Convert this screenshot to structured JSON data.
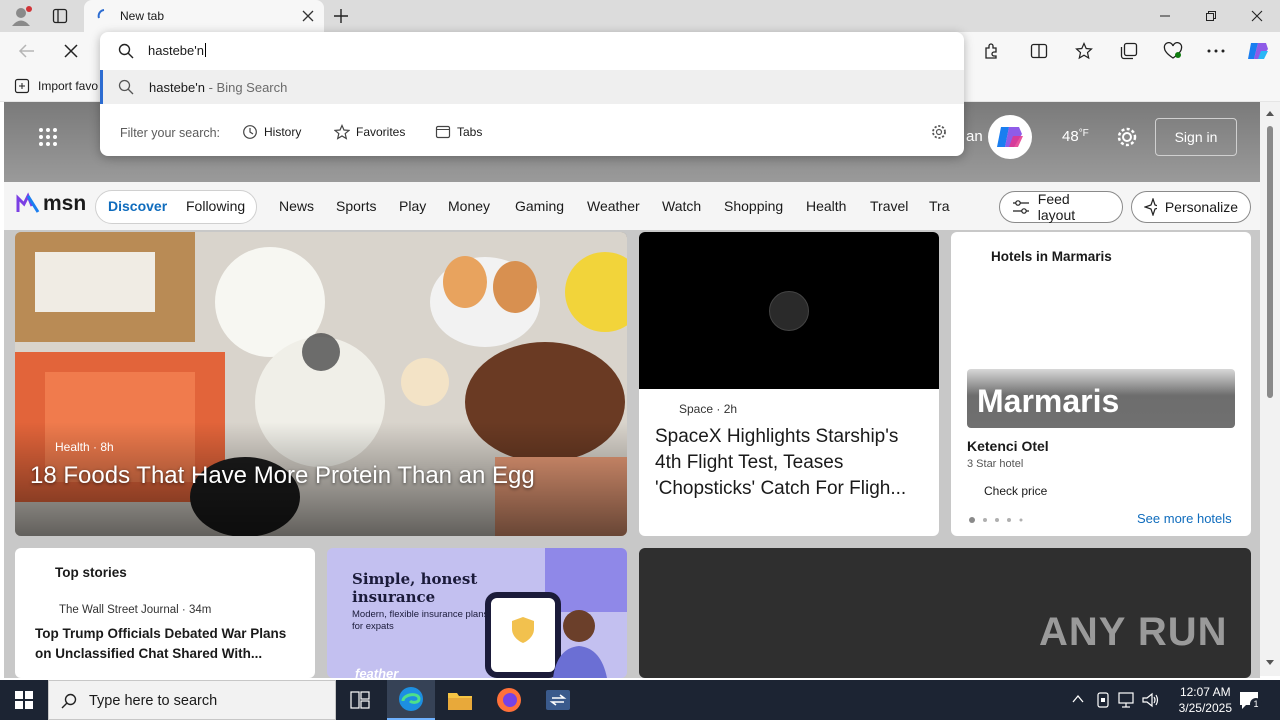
{
  "browser": {
    "tab_title": "New tab",
    "address_input": "hastebe'n",
    "favorites_import_label": "Import favo",
    "suggestion": {
      "query": "hastebe'n",
      "suffix": " - Bing Search"
    },
    "filter_label": "Filter your search:",
    "filters": [
      "History",
      "Favorites",
      "Tabs"
    ]
  },
  "msn_header": {
    "weather_temp": "48",
    "weather_unit": "°F",
    "sign_in": "Sign in",
    "partial_text": "an"
  },
  "msn_nav": {
    "logo": "msn",
    "tabs": [
      "Discover",
      "Following"
    ],
    "active_tab": "Discover",
    "items": [
      "News",
      "Sports",
      "Play",
      "Money",
      "Gaming",
      "Weather",
      "Watch",
      "Shopping",
      "Health",
      "Travel",
      "Tra"
    ],
    "feed_layout": "Feed layout",
    "personalize": "Personalize"
  },
  "cards": {
    "hero": {
      "category": "Health",
      "age": "8h",
      "title": "18 Foods That Have More Protein Than an Egg"
    },
    "space": {
      "category": "Space",
      "age": "2h",
      "title": "SpaceX Highlights Starship's 4th Flight Test, Teases 'Chopsticks' Catch For Fligh..."
    },
    "hotels": {
      "header": "Hotels in Marmaris",
      "image_label": "Marmaris",
      "name": "Ketenci Otel",
      "rating": "3 Star hotel",
      "cta": "Check price",
      "more": "See more hotels"
    },
    "top_stories": {
      "header": "Top stories",
      "source": "The Wall Street Journal",
      "age": "34m",
      "title": "Top Trump Officials Debated War Plans on Unclassified Chat Shared With..."
    },
    "ad": {
      "headline": "Simple, honest insurance",
      "subline": "Modern, flexible insurance plans for expats",
      "brand": "feather"
    },
    "video": {
      "watermark": "ANY RUN"
    }
  },
  "taskbar": {
    "search_placeholder": "Type here to search",
    "time": "12:07 AM",
    "date": "3/25/2025",
    "notification_count": "1"
  },
  "colors": {
    "accent": "#0f6cbd",
    "taskbar": "#1c2433",
    "hero_text": "#ffffff"
  }
}
